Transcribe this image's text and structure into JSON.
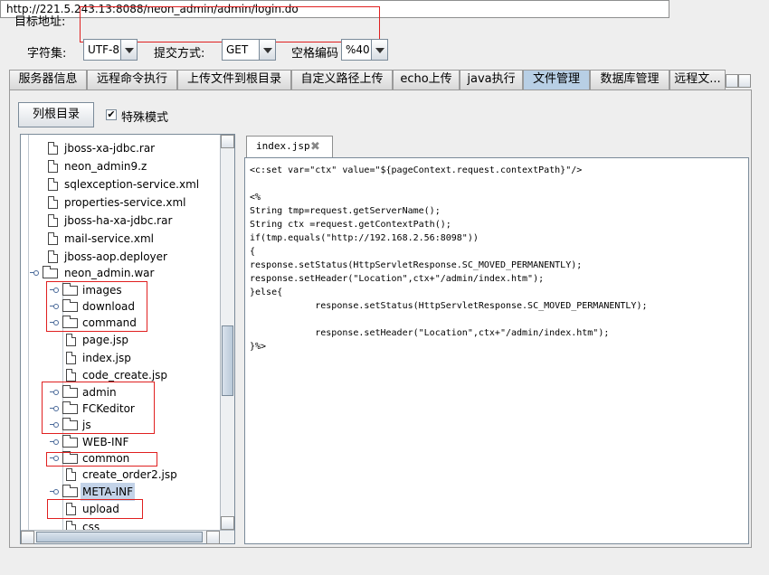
{
  "toolbar": {
    "target_label": "目标地址:",
    "target_url": "http://221.5.243.13:8088/neon_admin/admin/login.do",
    "charset_label": "字符集:",
    "charset_value": "UTF-8",
    "method_label": "提交方式:",
    "method_value": "GET",
    "space_label": "空格编码",
    "space_value": "%40"
  },
  "tabs": [
    {
      "label": "服务器信息"
    },
    {
      "label": "远程命令执行"
    },
    {
      "label": "上传文件到根目录"
    },
    {
      "label": "自定义路径上传"
    },
    {
      "label": "echo上传"
    },
    {
      "label": "java执行"
    },
    {
      "label": "文件管理",
      "active": true
    },
    {
      "label": "数据库管理"
    },
    {
      "label": "远程文..."
    }
  ],
  "file_manager": {
    "list_root_button": "列根目录",
    "special_mode_label": "特殊模式",
    "special_mode_checked": true
  },
  "tree": [
    {
      "label": "jboss-xa-jdbc.rar",
      "type": "file",
      "depth": 1
    },
    {
      "label": "neon_admin9.z",
      "type": "file",
      "depth": 1
    },
    {
      "label": "sqlexception-service.xml",
      "type": "file",
      "depth": 1
    },
    {
      "label": "properties-service.xml",
      "type": "file",
      "depth": 1
    },
    {
      "label": "jboss-ha-xa-jdbc.rar",
      "type": "file",
      "depth": 1
    },
    {
      "label": "mail-service.xml",
      "type": "file",
      "depth": 1
    },
    {
      "label": "jboss-aop.deployer",
      "type": "file",
      "depth": 1
    },
    {
      "label": "neon_admin.war",
      "type": "folder",
      "depth": 1
    },
    {
      "label": "images",
      "type": "folder",
      "depth": 2
    },
    {
      "label": "download",
      "type": "folder",
      "depth": 2
    },
    {
      "label": "command",
      "type": "folder",
      "depth": 2
    },
    {
      "label": "page.jsp",
      "type": "file",
      "depth": 2
    },
    {
      "label": "index.jsp",
      "type": "file",
      "depth": 2
    },
    {
      "label": "code_create.jsp",
      "type": "file",
      "depth": 2
    },
    {
      "label": "admin",
      "type": "folder",
      "depth": 2
    },
    {
      "label": "FCKeditor",
      "type": "folder",
      "depth": 2
    },
    {
      "label": "js",
      "type": "folder",
      "depth": 2
    },
    {
      "label": "WEB-INF",
      "type": "folder",
      "depth": 2
    },
    {
      "label": "common",
      "type": "folder",
      "depth": 2
    },
    {
      "label": "create_order2.jsp",
      "type": "file",
      "depth": 2
    },
    {
      "label": "META-INF",
      "type": "folder",
      "depth": 2,
      "selected": true
    },
    {
      "label": "upload",
      "type": "file",
      "depth": 2
    },
    {
      "label": "css",
      "type": "file",
      "depth": 2
    }
  ],
  "editor": {
    "tab_label": "index.jsp",
    "lines": [
      "<c:set var=\"ctx\" value=\"${pageContext.request.contextPath}\"/>",
      "",
      "<%",
      "String tmp=request.getServerName();",
      "String ctx =request.getContextPath();",
      "if(tmp.equals(\"http://192.168.2.56:8098\"))",
      "{",
      "response.setStatus(HttpServletResponse.SC_MOVED_PERMANENTLY);",
      "response.setHeader(\"Location\",ctx+\"/admin/index.htm\");",
      "}else{",
      "            response.setStatus(HttpServletResponse.SC_MOVED_PERMANENTLY);",
      "",
      "            response.setHeader(\"Location\",ctx+\"/admin/index.htm\");",
      "}%>"
    ]
  },
  "colors": {
    "highlight_box": "#e02020",
    "active_tab": "#b8cfe5",
    "selection": "#c3d3e8"
  }
}
